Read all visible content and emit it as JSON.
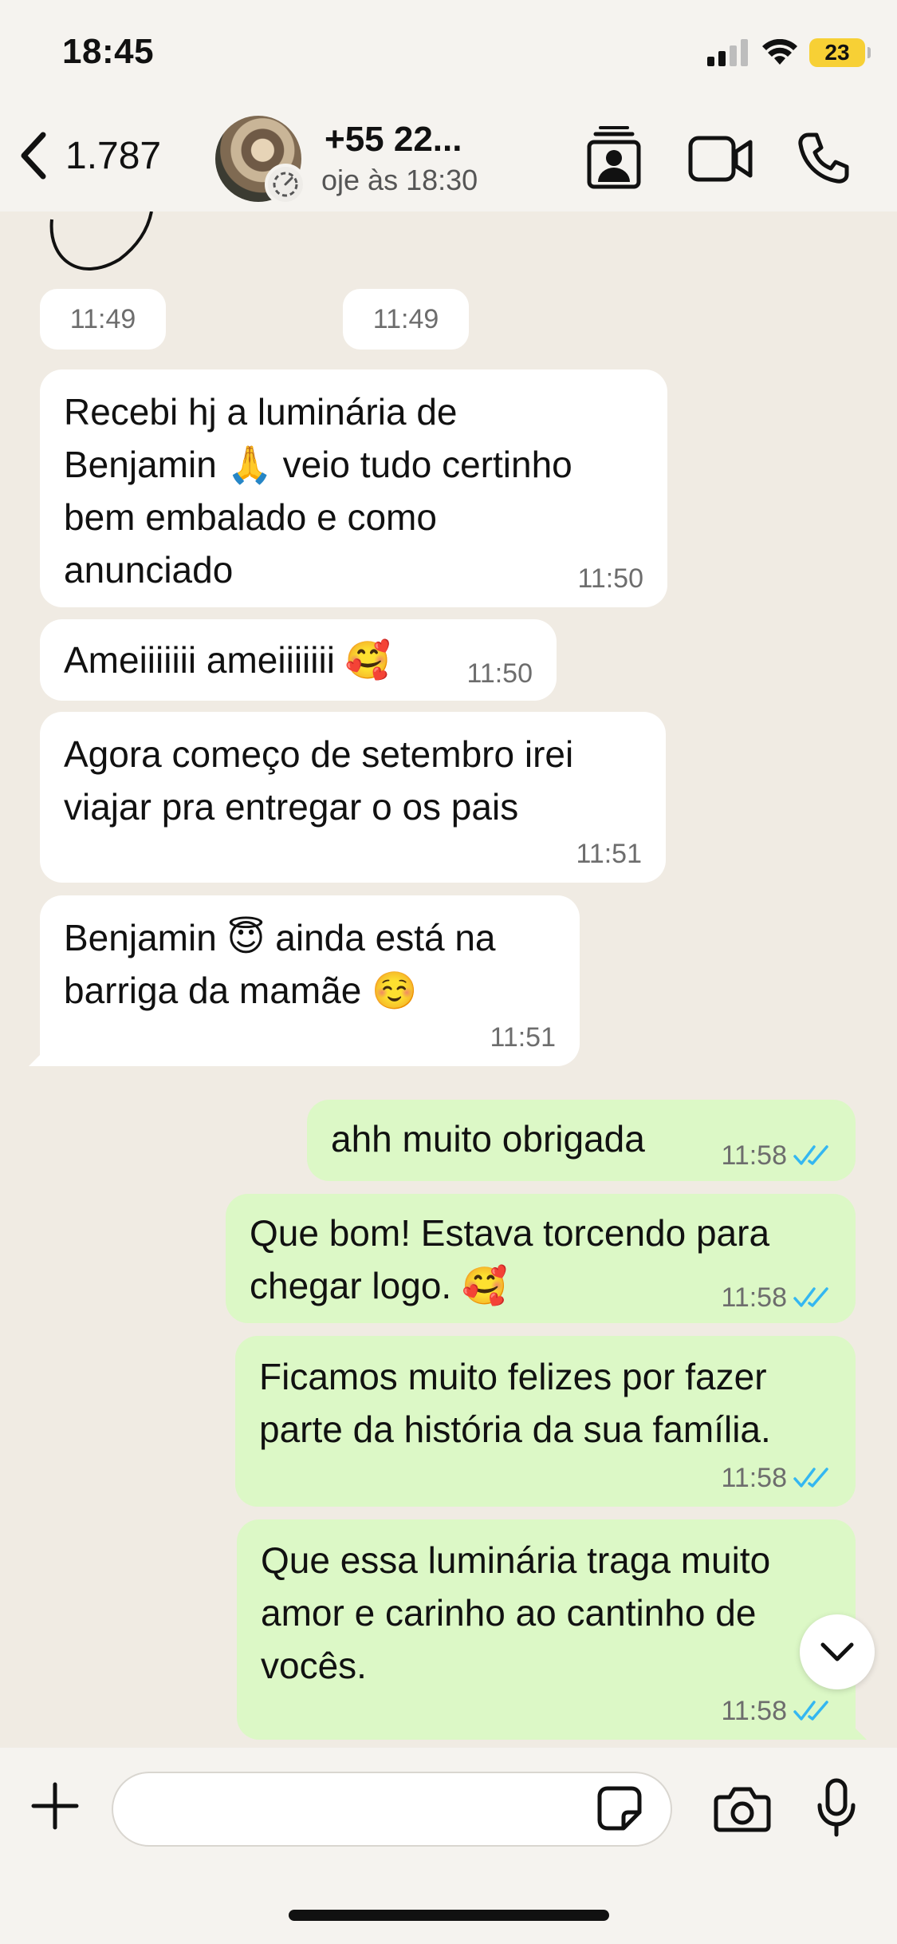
{
  "status_bar": {
    "time": "18:45",
    "battery": "23"
  },
  "header": {
    "back_count": "1.787",
    "contact_name": "+55 22...",
    "contact_status": "oje às 18:30"
  },
  "chat": {
    "time_chips": [
      "11:49",
      "11:49"
    ],
    "messages": [
      {
        "direction": "incoming",
        "text": "Recebi hj a luminária de\nBenjamin 🙏 veio tudo certinho\nbem embalado e como\nanunciado",
        "time": "11:50"
      },
      {
        "direction": "incoming",
        "text": "Ameiiiiiii ameiiiiiii 🥰",
        "time": "11:50"
      },
      {
        "direction": "incoming",
        "text": "Agora começo de setembro irei\nviajar pra entregar o os pais",
        "time": "11:51"
      },
      {
        "direction": "incoming",
        "text": "Benjamin 😇 ainda está na\nbarriga da mamãe ☺️",
        "time": "11:51"
      },
      {
        "direction": "outgoing",
        "text": "ahh muito obrigada",
        "time": "11:58"
      },
      {
        "direction": "outgoing",
        "text": "Que bom! Estava torcendo para\nchegar logo. 🥰",
        "time": "11:58"
      },
      {
        "direction": "outgoing",
        "text": "Ficamos muito felizes por fazer\nparte da história da sua família.",
        "time": "11:58"
      },
      {
        "direction": "outgoing",
        "text": "Que essa luminária traga muito\namor e carinho ao cantinho de\nvocês.",
        "time": "11:58"
      }
    ]
  },
  "composer": {
    "placeholder": ""
  },
  "colors": {
    "incoming_bubble": "#ffffff",
    "outgoing_bubble": "#dcf8c6",
    "read_ticks": "#34b7f1",
    "chat_background": "#f0ebe3"
  },
  "icons": [
    "back-chevron-icon",
    "avatar-status-icon",
    "contact-card-icon",
    "video-call-icon",
    "phone-call-icon",
    "chevron-down-icon",
    "plus-icon",
    "sticker-icon",
    "camera-icon",
    "mic-icon",
    "double-check-icon"
  ]
}
